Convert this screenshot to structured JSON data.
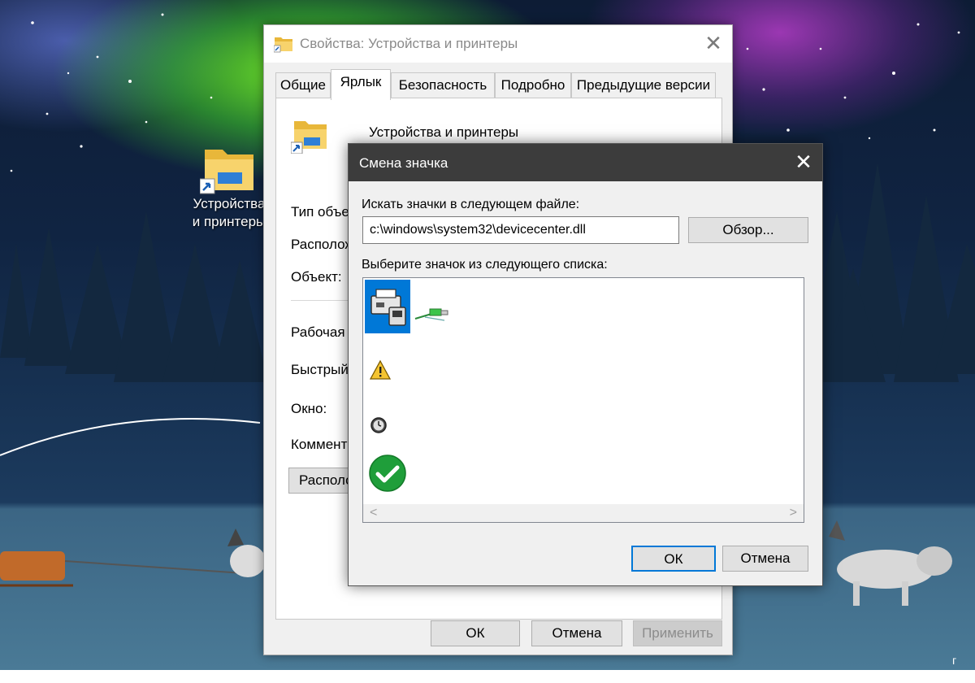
{
  "desktop": {
    "icon_label": "Устройства\nи принтеры",
    "icon_name": "devices-printers-folder-icon"
  },
  "properties_window": {
    "title": "Свойства: Устройства и принтеры",
    "close_glyph": "✕",
    "tabs": [
      {
        "label": "Общие",
        "active": false
      },
      {
        "label": "Ярлык",
        "active": true
      },
      {
        "label": "Безопасность",
        "active": false
      },
      {
        "label": "Подробно",
        "active": false
      },
      {
        "label": "Предыдущие версии",
        "active": false
      }
    ],
    "item_name": "Устройства и принтеры",
    "fields": [
      "Тип объе",
      "Располож",
      "Объект:",
      "Рабочая п",
      "Быстрый",
      "Окно:",
      "Коммент"
    ],
    "location_button": "Располо",
    "buttons": {
      "ok": "ОК",
      "cancel": "Отмена",
      "apply": "Применить"
    }
  },
  "change_icon_dialog": {
    "title": "Смена значка",
    "close_glyph": "✕",
    "search_label": "Искать значки в следующем файле:",
    "file_path": "c:\\windows\\system32\\devicecenter.dll",
    "browse_button": "Обзор...",
    "list_label": "Выберите значок из следующего списка:",
    "icons": [
      {
        "name": "printer-device-icon",
        "selected": true
      },
      {
        "name": "usb-cable-icon",
        "selected": false
      },
      {
        "name": "warning-icon",
        "selected": false
      },
      {
        "name": "clock-icon",
        "selected": false
      },
      {
        "name": "checkmark-icon",
        "selected": false
      }
    ],
    "scroll_left": "<",
    "scroll_right": ">",
    "buttons": {
      "ok": "ОК",
      "cancel": "Отмена"
    }
  },
  "colors": {
    "accent": "#0078d7",
    "dialog_titlebar": "#3c3c3c",
    "window_bg": "#f0f0f0"
  },
  "watermark": "г"
}
